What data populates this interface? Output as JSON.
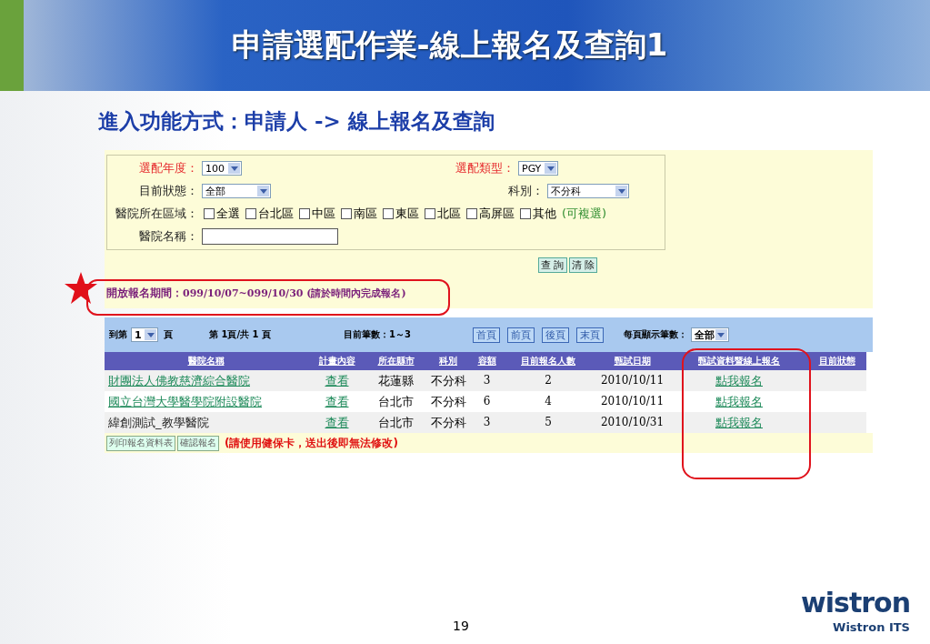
{
  "slide": {
    "title": "申請選配作業-線上報名及查詢1",
    "subtitle": "進入功能方式：申請人 -> 線上報名及查詢",
    "page_number": "19"
  },
  "form": {
    "row1": [
      {
        "label": "選配年度：",
        "value": "100",
        "required": true
      },
      {
        "label": "選配類型：",
        "value": "PGY",
        "required": true
      }
    ],
    "row2": [
      {
        "label": "目前狀態：",
        "value": "全部",
        "required": false
      },
      {
        "label": "科別：",
        "value": "不分科",
        "required": false
      }
    ],
    "region_label": "醫院所在區域：",
    "regions": [
      {
        "label": "全選",
        "checked": false
      },
      {
        "label": "台北區",
        "checked": false
      },
      {
        "label": "中區",
        "checked": false
      },
      {
        "label": "南區",
        "checked": false
      },
      {
        "label": "東區",
        "checked": false
      },
      {
        "label": "北區",
        "checked": false
      },
      {
        "label": "高屏區",
        "checked": false
      },
      {
        "label": "其他",
        "checked": false
      }
    ],
    "region_note": "(可複選)",
    "name_label": "醫院名稱：",
    "buttons": [
      "查 詢",
      "清 除"
    ],
    "period_label": "開放報名期間：",
    "period_value": "099/10/07~099/10/30 (請於時間內完成報名)"
  },
  "toolbar": {
    "goto_before": "到第",
    "page_select": "1",
    "goto_after": "頁",
    "page_info": "第 1頁/共 1 頁",
    "count": "目前筆數：1～3",
    "pager": [
      "首頁",
      "前頁",
      "後頁",
      "末頁"
    ],
    "per_page_label": "每頁顯示筆數：",
    "per_page": "全部"
  },
  "table": {
    "columns": [
      "醫院名稱",
      "計畫內容",
      "所在縣市",
      "科別",
      "容額",
      "目前報名人數",
      "甄試日期",
      "甄試資料暨線上報名",
      "目前狀態"
    ],
    "rows": [
      {
        "hospital": "財團法人佛教慈濟綜合醫院",
        "hospital_link": true,
        "plan": "查看",
        "city": "花蓮縣",
        "dept": "不分科",
        "quota": "3",
        "applicants": "2",
        "date": "2010/10/11",
        "apply": "點我報名"
      },
      {
        "hospital": "國立台灣大學醫學院附設醫院",
        "hospital_link": true,
        "plan": "查看",
        "city": "台北市",
        "dept": "不分科",
        "quota": "6",
        "applicants": "4",
        "date": "2010/10/11",
        "apply": "點我報名"
      },
      {
        "hospital": "緯創測試_教學醫院",
        "hospital_link": false,
        "plan": "查看",
        "city": "台北市",
        "dept": "不分科",
        "quota": "3",
        "applicants": "5",
        "date": "2010/10/31",
        "apply": "點我報名"
      }
    ]
  },
  "footer": {
    "buttons": [
      "列印報名資料表",
      "確認報名"
    ],
    "note": "(請使用健保卡，送出後即無法修改)"
  },
  "logo": {
    "word": "wistron",
    "caption": "Wistron ITS"
  }
}
